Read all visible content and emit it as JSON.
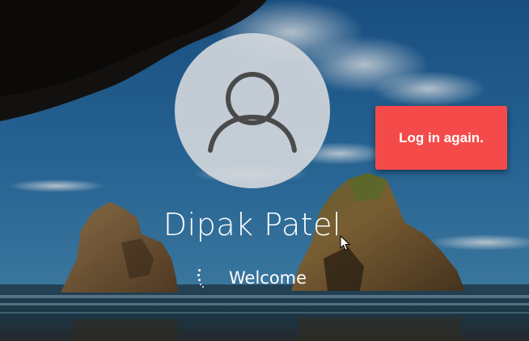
{
  "lock_screen": {
    "user_name": "Dipak Patel",
    "status_text": "Welcome"
  },
  "popup": {
    "button_label": "Log in again."
  },
  "colors": {
    "accent_red": "#f54a4a",
    "avatar_circle": "#d0d5da",
    "avatar_glyph": "#4a4a4a",
    "text": "#ffffff"
  },
  "icons": {
    "avatar": "user-silhouette-icon",
    "spinner": "loading-dots-icon",
    "cursor": "mouse-pointer-icon"
  }
}
